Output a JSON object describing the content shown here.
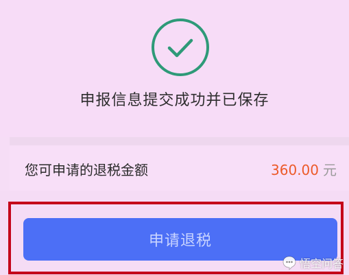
{
  "colors": {
    "background": "#f6ddf6",
    "check_circle": "#2e9a78",
    "amount_value": "#ec5a29",
    "button_bg": "#4c6ff6",
    "highlight_frame": "#c4041a"
  },
  "success": {
    "icon": "check-circle-icon",
    "message": "申报信息提交成功并已保存"
  },
  "refund": {
    "label": "您可申请的退税金额",
    "amount": "360.00",
    "unit": "元"
  },
  "actions": {
    "apply_refund_label": "申请退税"
  },
  "watermark": {
    "icon": "speech-bubble-icon",
    "text": "悟空问答"
  }
}
